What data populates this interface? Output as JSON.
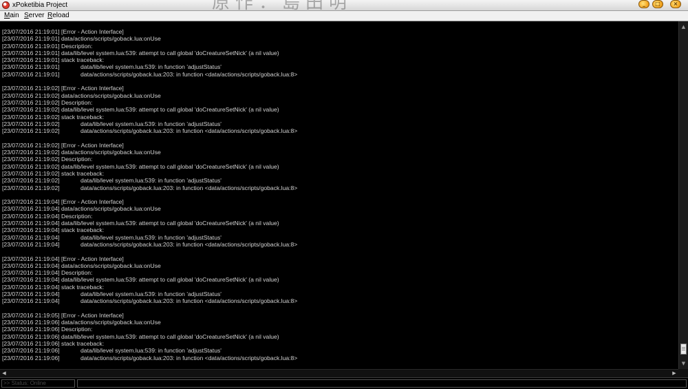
{
  "window": {
    "title": "xPoketibia Project",
    "watermark": "原作：島田明",
    "minimize_glyph": "_",
    "maximize_glyph": "□",
    "close_glyph": "×"
  },
  "menu": {
    "main": {
      "acc": "M",
      "rest": "ain"
    },
    "server": {
      "acc": "S",
      "rest": "erver"
    },
    "reload": {
      "acc": "R",
      "rest": "eload"
    }
  },
  "console": {
    "lines": [
      {
        "ts": "[23/07/2016 21:19:01]",
        "msg": "[Error - Action Interface]",
        "trace": false
      },
      {
        "ts": "[23/07/2016 21:19:01]",
        "msg": "data/actions/scripts/goback.lua:onUse",
        "trace": false
      },
      {
        "ts": "[23/07/2016 21:19:01]",
        "msg": "Description:",
        "trace": false
      },
      {
        "ts": "[23/07/2016 21:19:01]",
        "msg": "data/lib/level system.lua:539: attempt to call global 'doCreatureSetNick' (a nil value)",
        "trace": false
      },
      {
        "ts": "[23/07/2016 21:19:01]",
        "msg": "stack traceback:",
        "trace": false
      },
      {
        "ts": "[23/07/2016 21:19:01]",
        "msg": "data/lib/level system.lua:539: in function 'adjustStatus'",
        "trace": true
      },
      {
        "ts": "[23/07/2016 21:19:01]",
        "msg": "data/actions/scripts/goback.lua:203: in function <data/actions/scripts/goback.lua:8>",
        "trace": true
      },
      {
        "ts": "",
        "msg": "",
        "trace": false
      },
      {
        "ts": "[23/07/2016 21:19:02]",
        "msg": "[Error - Action Interface]",
        "trace": false
      },
      {
        "ts": "[23/07/2016 21:19:02]",
        "msg": "data/actions/scripts/goback.lua:onUse",
        "trace": false
      },
      {
        "ts": "[23/07/2016 21:19:02]",
        "msg": "Description:",
        "trace": false
      },
      {
        "ts": "[23/07/2016 21:19:02]",
        "msg": "data/lib/level system.lua:539: attempt to call global 'doCreatureSetNick' (a nil value)",
        "trace": false
      },
      {
        "ts": "[23/07/2016 21:19:02]",
        "msg": "stack traceback:",
        "trace": false
      },
      {
        "ts": "[23/07/2016 21:19:02]",
        "msg": "data/lib/level system.lua:539: in function 'adjustStatus'",
        "trace": true
      },
      {
        "ts": "[23/07/2016 21:19:02]",
        "msg": "data/actions/scripts/goback.lua:203: in function <data/actions/scripts/goback.lua:8>",
        "trace": true
      },
      {
        "ts": "",
        "msg": "",
        "trace": false
      },
      {
        "ts": "[23/07/2016 21:19:02]",
        "msg": "[Error - Action Interface]",
        "trace": false
      },
      {
        "ts": "[23/07/2016 21:19:02]",
        "msg": "data/actions/scripts/goback.lua:onUse",
        "trace": false
      },
      {
        "ts": "[23/07/2016 21:19:02]",
        "msg": "Description:",
        "trace": false
      },
      {
        "ts": "[23/07/2016 21:19:02]",
        "msg": "data/lib/level system.lua:539: attempt to call global 'doCreatureSetNick' (a nil value)",
        "trace": false
      },
      {
        "ts": "[23/07/2016 21:19:02]",
        "msg": "stack traceback:",
        "trace": false
      },
      {
        "ts": "[23/07/2016 21:19:02]",
        "msg": "data/lib/level system.lua:539: in function 'adjustStatus'",
        "trace": true
      },
      {
        "ts": "[23/07/2016 21:19:02]",
        "msg": "data/actions/scripts/goback.lua:203: in function <data/actions/scripts/goback.lua:8>",
        "trace": true
      },
      {
        "ts": "",
        "msg": "",
        "trace": false
      },
      {
        "ts": "[23/07/2016 21:19:04]",
        "msg": "[Error - Action Interface]",
        "trace": false
      },
      {
        "ts": "[23/07/2016 21:19:04]",
        "msg": "data/actions/scripts/goback.lua:onUse",
        "trace": false
      },
      {
        "ts": "[23/07/2016 21:19:04]",
        "msg": "Description:",
        "trace": false
      },
      {
        "ts": "[23/07/2016 21:19:04]",
        "msg": "data/lib/level system.lua:539: attempt to call global 'doCreatureSetNick' (a nil value)",
        "trace": false
      },
      {
        "ts": "[23/07/2016 21:19:04]",
        "msg": "stack traceback:",
        "trace": false
      },
      {
        "ts": "[23/07/2016 21:19:04]",
        "msg": "data/lib/level system.lua:539: in function 'adjustStatus'",
        "trace": true
      },
      {
        "ts": "[23/07/2016 21:19:04]",
        "msg": "data/actions/scripts/goback.lua:203: in function <data/actions/scripts/goback.lua:8>",
        "trace": true
      },
      {
        "ts": "",
        "msg": "",
        "trace": false
      },
      {
        "ts": "[23/07/2016 21:19:04]",
        "msg": "[Error - Action Interface]",
        "trace": false
      },
      {
        "ts": "[23/07/2016 21:19:04]",
        "msg": "data/actions/scripts/goback.lua:onUse",
        "trace": false
      },
      {
        "ts": "[23/07/2016 21:19:04]",
        "msg": "Description:",
        "trace": false
      },
      {
        "ts": "[23/07/2016 21:19:04]",
        "msg": "data/lib/level system.lua:539: attempt to call global 'doCreatureSetNick' (a nil value)",
        "trace": false
      },
      {
        "ts": "[23/07/2016 21:19:04]",
        "msg": "stack traceback:",
        "trace": false
      },
      {
        "ts": "[23/07/2016 21:19:04]",
        "msg": "data/lib/level system.lua:539: in function 'adjustStatus'",
        "trace": true
      },
      {
        "ts": "[23/07/2016 21:19:04]",
        "msg": "data/actions/scripts/goback.lua:203: in function <data/actions/scripts/goback.lua:8>",
        "trace": true
      },
      {
        "ts": "",
        "msg": "",
        "trace": false
      },
      {
        "ts": "[23/07/2016 21:19:05]",
        "msg": "[Error - Action Interface]",
        "trace": false
      },
      {
        "ts": "[23/07/2016 21:19:06]",
        "msg": "data/actions/scripts/goback.lua:onUse",
        "trace": false
      },
      {
        "ts": "[23/07/2016 21:19:06]",
        "msg": "Description:",
        "trace": false
      },
      {
        "ts": "[23/07/2016 21:19:06]",
        "msg": "data/lib/level system.lua:539: attempt to call global 'doCreatureSetNick' (a nil value)",
        "trace": false
      },
      {
        "ts": "[23/07/2016 21:19:06]",
        "msg": "stack traceback:",
        "trace": false
      },
      {
        "ts": "[23/07/2016 21:19:06]",
        "msg": "data/lib/level system.lua:539: in function 'adjustStatus'",
        "trace": true
      },
      {
        "ts": "[23/07/2016 21:19:06]",
        "msg": "data/actions/scripts/goback.lua:203: in function <data/actions/scripts/goback.lua:8>",
        "trace": true
      }
    ]
  },
  "scroll": {
    "up_glyph": "▲",
    "down_glyph": "▼",
    "left_glyph": "◀",
    "right_glyph": "▶"
  },
  "statusbar": {
    "status_text": ">> Status: Online",
    "command_value": ""
  },
  "colors": {
    "console_bg": "#000000",
    "console_text": "#d2d2d2",
    "accent_close": "#f3a21b"
  },
  "icons": {
    "app": "red-circle-app-icon",
    "minimize": "minimize-icon",
    "maximize": "maximize-icon",
    "close": "close-icon"
  }
}
